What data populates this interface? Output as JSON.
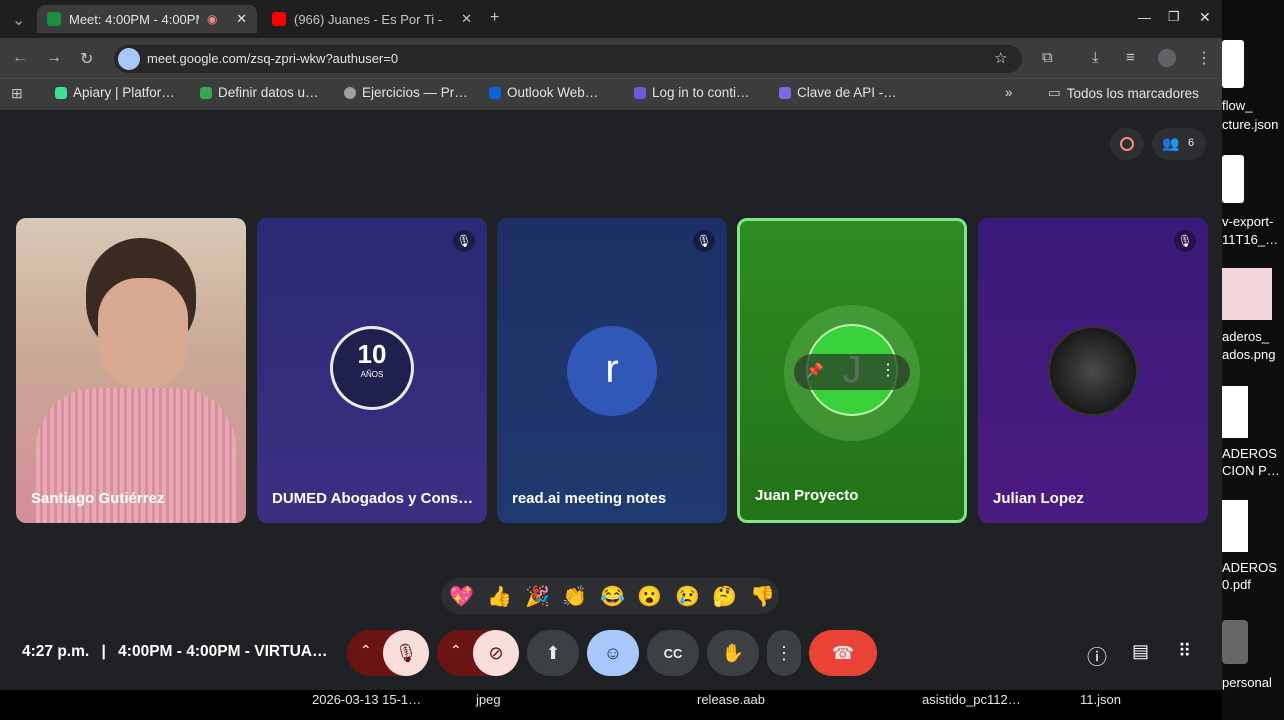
{
  "browser": {
    "tabs": [
      {
        "title": "Meet: 4:00PM - 4:00PM",
        "active": true
      },
      {
        "title": "(966) Juanes - Es Por Ti -",
        "active": false
      }
    ],
    "url": "meet.google.com/zsq-zpri-wkw?authuser=0",
    "bookmarks": [
      "Apiary | Platfor…",
      "Definir datos u…",
      "Ejercicios — Pr…",
      "Outlook Web…",
      "Log in to conti…",
      "Clave de API -…"
    ],
    "all_bookmarks": "Todos los marcadores",
    "overflow": "»"
  },
  "meet": {
    "participant_count": "6",
    "tiles": [
      {
        "name": "Santiago Gutiérrez",
        "type": "video"
      },
      {
        "name": "DUMED Abogados y Cons…",
        "type": "logo",
        "logo_number": "10",
        "logo_text": "AÑOS",
        "muted": true
      },
      {
        "name": "read.ai meeting notes",
        "type": "avatar",
        "initial": "r",
        "muted": true
      },
      {
        "name": "Juan Proyecto",
        "type": "avatar",
        "initial": "J",
        "speaking": true
      },
      {
        "name": "Julian Lopez",
        "type": "image",
        "muted": true
      }
    ],
    "reactions": [
      "💖",
      "👍",
      "🎉",
      "👏",
      "😂",
      "😮",
      "😢",
      "🤔",
      "👎"
    ],
    "time": "4:27 p.m.",
    "separator": "|",
    "meeting_title": "4:00PM - 4:00PM - VIRTUA…",
    "colors": {
      "end_call": "#ea4335",
      "speaking_border": "#7ee787",
      "active_control": "#f9dedc",
      "emoji_active": "#a8c7fa"
    }
  },
  "desktop": {
    "labels": [
      "flow_",
      "cture.json",
      "v-export-",
      "11T16_…",
      "aderos_",
      "ados.png",
      "ADEROS",
      "CION P…",
      "ADEROS",
      "0.pdf",
      "personal"
    ]
  },
  "taskbar": [
    "2026-03-13 15-1…",
    "jpeg",
    "release.aab",
    "asistido_pc112…",
    "11.json"
  ]
}
